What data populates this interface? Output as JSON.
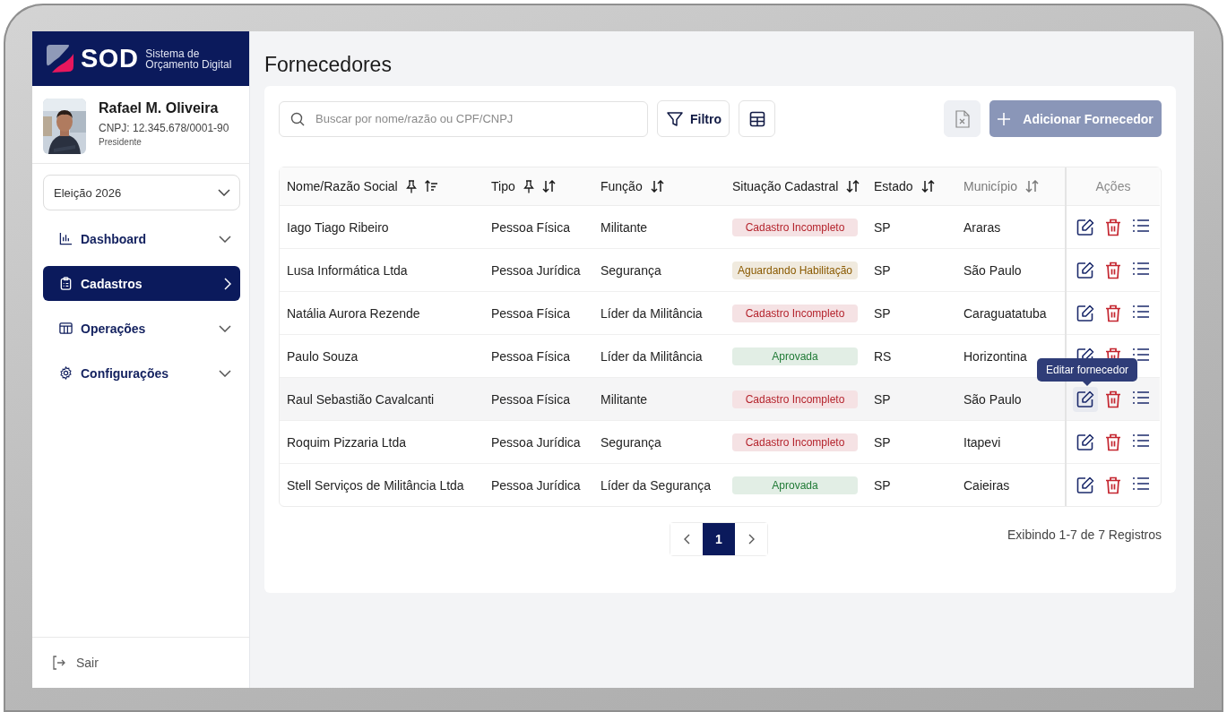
{
  "brand": {
    "name": "SOD",
    "subtitle_lines": [
      "Sistema de",
      "Orçamento Digital"
    ]
  },
  "profile": {
    "name": "Rafael M. Oliveira",
    "document": "CNPJ: 12.345.678/0001-90",
    "role": "Presidente"
  },
  "campaign_select": {
    "value": "Eleição 2026"
  },
  "nav": [
    {
      "label": "Dashboard",
      "selected": false
    },
    {
      "label": "Cadastros",
      "selected": true
    },
    {
      "label": "Operações",
      "selected": false
    },
    {
      "label": "Configurações",
      "selected": false
    }
  ],
  "logout": {
    "label": "Sair"
  },
  "page_title": "Fornecedores",
  "search": {
    "placeholder": "Buscar por nome/razão ou CPF/CNPJ"
  },
  "filter_button": {
    "label": "Filtro"
  },
  "add_button": {
    "label": "Adicionar Fornecedor"
  },
  "table": {
    "columns": [
      {
        "label": "Nome/Razão Social",
        "pinned": true,
        "sorted": true,
        "muted": false
      },
      {
        "label": "Tipo",
        "pinned": true,
        "sorted": false,
        "muted": false
      },
      {
        "label": "Função",
        "pinned": false,
        "sorted": false,
        "muted": false
      },
      {
        "label": "Situação Cadastral",
        "pinned": false,
        "sorted": false,
        "muted": false
      },
      {
        "label": "Estado",
        "pinned": false,
        "sorted": false,
        "muted": false
      },
      {
        "label": "Município",
        "pinned": false,
        "sorted": false,
        "muted": true
      }
    ],
    "actions_label": "Ações",
    "rows": [
      {
        "name": "Iago Tiago Ribeiro",
        "type": "Pessoa Física",
        "role": "Militante",
        "status": {
          "text": "Cadastro Incompleto",
          "color": "#b4232c"
        },
        "state": "SP",
        "city": "Araras",
        "highlighted": false
      },
      {
        "name": "Lusa Informática Ltda",
        "type": "Pessoa Jurídica",
        "role": "Segurança",
        "status": {
          "text": "Aguardando Habilitação",
          "color": "#8a5a00"
        },
        "state": "SP",
        "city": "São Paulo",
        "highlighted": false
      },
      {
        "name": "Natália Aurora Rezende",
        "type": "Pessoa Física",
        "role": "Líder da Militância",
        "status": {
          "text": "Cadastro Incompleto",
          "color": "#b4232c"
        },
        "state": "SP",
        "city": "Caraguatatuba",
        "highlighted": false
      },
      {
        "name": "Paulo Souza",
        "type": "Pessoa Física",
        "role": "Líder da Militância",
        "status": {
          "text": "Aprovada",
          "color": "#1f7a35"
        },
        "state": "RS",
        "city": "Horizontina",
        "highlighted": false
      },
      {
        "name": "Raul Sebastião Cavalcanti",
        "type": "Pessoa Física",
        "role": "Militante",
        "status": {
          "text": "Cadastro Incompleto",
          "color": "#b4232c"
        },
        "state": "SP",
        "city": "São Paulo",
        "highlighted": true
      },
      {
        "name": "Roquim Pizzaria Ltda",
        "type": "Pessoa Jurídica",
        "role": "Segurança",
        "status": {
          "text": "Cadastro Incompleto",
          "color": "#b4232c"
        },
        "state": "SP",
        "city": "Itapevi",
        "highlighted": false
      },
      {
        "name": "Stell Serviços de Militância Ltda",
        "type": "Pessoa Jurídica",
        "role": "Líder da Segurança",
        "status": {
          "text": "Aprovada",
          "color": "#1f7a35"
        },
        "state": "SP",
        "city": "Caieiras",
        "highlighted": false
      }
    ]
  },
  "tooltip": {
    "text": "Editar fornecedor"
  },
  "pagination": {
    "pages": [
      {
        "label": "1",
        "selected": true
      }
    ],
    "summary": "Exibindo 1-7 de 7 Registros"
  }
}
